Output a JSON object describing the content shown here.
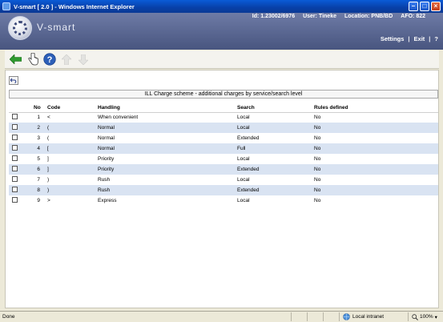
{
  "window": {
    "title": "V-smart [ 2.0 ] - Windows Internet Explorer"
  },
  "header": {
    "brand": "V-smart",
    "id_text": "Id: 1.23002/6976",
    "user_text": "User: Tineke",
    "location_text": "Location: PNB/BD",
    "afo_text": "AFO: 822",
    "settings_label": "Settings",
    "separator": "|",
    "exit_label": "Exit",
    "help_label": "?"
  },
  "panel": {
    "caption": "ILL Charge scheme - additional charges by service/search level",
    "columns": {
      "no": "No",
      "code": "Code",
      "handling": "Handling",
      "search": "Search",
      "rules": "Rules defined"
    },
    "rows": [
      {
        "no": "1",
        "code": "<",
        "handling": "When convenient",
        "search": "Local",
        "rules": "No"
      },
      {
        "no": "2",
        "code": "(",
        "handling": "Normal",
        "search": "Local",
        "rules": "No"
      },
      {
        "no": "3",
        "code": "(",
        "handling": "Normal",
        "search": "Extended",
        "rules": "No"
      },
      {
        "no": "4",
        "code": "[",
        "handling": "Normal",
        "search": "Full",
        "rules": "No"
      },
      {
        "no": "5",
        "code": "]",
        "handling": "Priority",
        "search": "Local",
        "rules": "No"
      },
      {
        "no": "6",
        "code": "]",
        "handling": "Priority",
        "search": "Extended",
        "rules": "No"
      },
      {
        "no": "7",
        "code": ")",
        "handling": "Rush",
        "search": "Local",
        "rules": "No"
      },
      {
        "no": "8",
        "code": ")",
        "handling": "Rush",
        "search": "Extended",
        "rules": "No"
      },
      {
        "no": "9",
        "code": ">",
        "handling": "Express",
        "search": "Local",
        "rules": "No"
      }
    ]
  },
  "statusbar": {
    "left": "Done",
    "zone": "Local intranet",
    "zoom": "100%"
  },
  "icons": {
    "back": "back-arrow-icon",
    "select": "hand-pointer-icon",
    "help": "help-icon",
    "up": "arrow-up-icon",
    "down": "arrow-down-icon",
    "undo": "undo-icon"
  },
  "colors": {
    "header": "#5a6791",
    "row_alt": "#d9e3f2",
    "back_arrow": "#2e9a2e",
    "help": "#2d5fb8"
  }
}
